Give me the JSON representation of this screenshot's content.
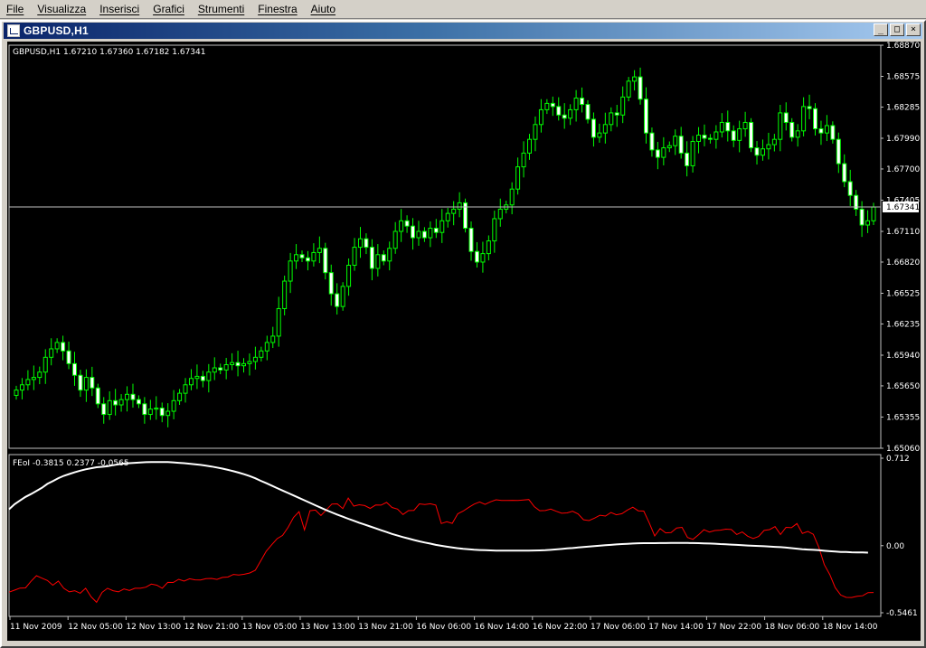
{
  "menu": [
    "File",
    "Visualizza",
    "Inserisci",
    "Grafici",
    "Strumenti",
    "Finestra",
    "Aiuto"
  ],
  "window": {
    "title": "GBPUSD,H1",
    "btn_min": "_",
    "btn_max": "□",
    "btn_close": "×"
  },
  "colors": {
    "bull": "#00ff00",
    "bear_body": "#ffffff",
    "grid": "#c0c0c0",
    "fisher": "#ff0000",
    "signal": "#ffffff",
    "axis_text": "#ffffff"
  },
  "chart_data": [
    {
      "type": "candlestick",
      "title": "GBPUSD,H1  1.67210 1.67360 1.67182 1.67341",
      "ylim": [
        1.6506,
        1.6887
      ],
      "y_ticks": [
        "1.68870",
        "1.68575",
        "1.68285",
        "1.67990",
        "1.67700",
        "1.67405",
        "1.67110",
        "1.66820",
        "1.66525",
        "1.66235",
        "1.65940",
        "1.65650",
        "1.65355",
        "1.65060"
      ],
      "last_price": "1.67341",
      "last_price_value": 1.67341,
      "closes": [
        1.6561,
        1.6566,
        1.6571,
        1.6573,
        1.6578,
        1.6592,
        1.66,
        1.6606,
        1.6598,
        1.6586,
        1.6575,
        1.6561,
        1.6573,
        1.6563,
        1.6548,
        1.6538,
        1.6551,
        1.6547,
        1.6552,
        1.6557,
        1.6552,
        1.6548,
        1.6538,
        1.6543,
        1.6544,
        1.6537,
        1.6541,
        1.6551,
        1.6558,
        1.6566,
        1.6572,
        1.6574,
        1.657,
        1.6578,
        1.6582,
        1.658,
        1.6585,
        1.6587,
        1.6584,
        1.6586,
        1.6588,
        1.6592,
        1.6598,
        1.6606,
        1.6612,
        1.6638,
        1.6664,
        1.6683,
        1.6689,
        1.6686,
        1.6683,
        1.6691,
        1.6695,
        1.6672,
        1.6652,
        1.664,
        1.6659,
        1.6679,
        1.6696,
        1.6704,
        1.6696,
        1.6676,
        1.6689,
        1.6683,
        1.6695,
        1.6711,
        1.6721,
        1.6716,
        1.6705,
        1.6711,
        1.6705,
        1.6714,
        1.671,
        1.6721,
        1.6728,
        1.6732,
        1.6738,
        1.6714,
        1.6692,
        1.6682,
        1.669,
        1.6702,
        1.6723,
        1.6732,
        1.6736,
        1.6751,
        1.6772,
        1.6785,
        1.6798,
        1.6812,
        1.6826,
        1.6832,
        1.6829,
        1.6821,
        1.6818,
        1.6826,
        1.6837,
        1.6831,
        1.6817,
        1.68,
        1.6804,
        1.6812,
        1.6823,
        1.6821,
        1.6838,
        1.6853,
        1.6857,
        1.6836,
        1.6804,
        1.6788,
        1.6781,
        1.679,
        1.6792,
        1.6801,
        1.6785,
        1.6773,
        1.6796,
        1.6802,
        1.6799,
        1.6798,
        1.6805,
        1.6814,
        1.6806,
        1.6797,
        1.6808,
        1.6814,
        1.679,
        1.6783,
        1.6789,
        1.6793,
        1.6798,
        1.6823,
        1.6814,
        1.68,
        1.6806,
        1.6829,
        1.6827,
        1.6808,
        1.6804,
        1.6811,
        1.6798,
        1.6775,
        1.6758,
        1.6745,
        1.6732,
        1.6717,
        1.6721,
        1.6734
      ]
    },
    {
      "type": "line",
      "title": "FEoI -0.3815 0.2377 -0.0565",
      "ylim": [
        -0.5461,
        0.712
      ],
      "y_ticks": [
        "0.712",
        "0.00",
        "-0.5461"
      ],
      "series": [
        {
          "values": [
            -0.3785,
            -0.362,
            -0.3456,
            -0.3441,
            -0.291,
            -0.2446,
            -0.2641,
            -0.2836,
            -0.3216,
            -0.2886,
            -0.3467,
            -0.3762,
            -0.3667,
            -0.3871,
            -0.3467,
            -0.4167,
            -0.4611,
            -0.38,
            -0.3467,
            -0.3667,
            -0.3762,
            -0.3526,
            -0.3641,
            -0.3467,
            -0.3467,
            -0.3377,
            -0.3132,
            -0.3216,
            -0.3467,
            -0.2986,
            -0.2996,
            -0.2741,
            -0.2886,
            -0.2696,
            -0.2786,
            -0.2791,
            -0.2686,
            -0.2666,
            -0.2746,
            -0.2581,
            -0.2556,
            -0.2341,
            -0.2386,
            -0.2326,
            -0.2222,
            -0.2001,
            -0.1236,
            -0.0451,
            0.0069,
            0.0574,
            0.0834,
            0.1494,
            0.2299,
            0.2769,
            0.1289,
            0.2844,
            0.2899,
            0.2459,
            0.2909,
            0.3389,
            0.3404,
            0.3024,
            0.3879,
            0.3219,
            0.3329,
            0.3264,
            0.3039,
            0.3309,
            0.3299,
            0.3519,
            0.3109,
            0.2978,
            0.2538,
            0.2853,
            0.2878,
            0.3408,
            0.3353,
            0.3413,
            0.3299,
            0.1798,
            0.1948,
            0.1813,
            0.2598,
            0.2813,
            0.3119,
            0.3379,
            0.3559,
            0.3359,
            0.3574,
            0.3739,
            0.3679,
            0.3679,
            0.3694,
            0.3679,
            0.3714,
            0.3759,
            0.3169,
            0.2849,
            0.2863,
            0.2978,
            0.2798,
            0.2638,
            0.2668,
            0.2798,
            0.2578,
            0.2108,
            0.2043,
            0.2244,
            0.2478,
            0.2408,
            0.2698,
            0.2518,
            0.2603,
            0.2898,
            0.3129,
            0.2838,
            0.2818,
            0.1868,
            0.0793,
            0.1398,
            0.1044,
            0.1069,
            0.1438,
            0.1489,
            0.0664,
            0.0514,
            0.0878,
            0.1299,
            0.1108,
            0.1234,
            0.1263,
            0.1348,
            0.1313,
            0.0908,
            0.1113,
            0.0774,
            0.0584,
            0.0748,
            0.1244,
            0.1308,
            0.1549,
            0.0913,
            0.1489,
            0.1463,
            0.1798,
            0.0998,
            0.1164,
            0.0924,
            -0.0125,
            -0.1536,
            -0.2346,
            -0.3416,
            -0.4016,
            -0.4211,
            -0.4221,
            -0.4121,
            -0.4076,
            -0.3821,
            -0.3815
          ]
        },
        {
          "values": [
            0.2962,
            0.3377,
            0.3677,
            0.3972,
            0.4198,
            0.4448,
            0.4708,
            0.5033,
            0.5253,
            0.5493,
            0.5683,
            0.5833,
            0.5973,
            0.6103,
            0.6213,
            0.6303,
            0.6383,
            0.6418,
            0.6463,
            0.6553,
            0.6623,
            0.6683,
            0.6718,
            0.6748,
            0.6773,
            0.6793,
            0.6808,
            0.6808,
            0.6808,
            0.6801,
            0.6778,
            0.6748,
            0.6713,
            0.6673,
            0.6628,
            0.6578,
            0.6513,
            0.6443,
            0.6363,
            0.6273,
            0.6173,
            0.6063,
            0.5943,
            0.5813,
            0.5663,
            0.5483,
            0.5283,
            0.5088,
            0.4888,
            0.4688,
            0.4488,
            0.4288,
            0.4088,
            0.3888,
            0.3688,
            0.3488,
            0.3288,
            0.3088,
            0.2888,
            0.2708,
            0.2528,
            0.2358,
            0.2188,
            0.2028,
            0.1868,
            0.1718,
            0.1568,
            0.1408,
            0.1258,
            0.1108,
            0.0958,
            0.0823,
            0.0698,
            0.0578,
            0.0458,
            0.0353,
            0.0258,
            0.0168,
            0.0068,
            -0.0012,
            -0.0082,
            -0.0147,
            -0.0207,
            -0.0257,
            -0.0297,
            -0.0332,
            -0.0352,
            -0.0372,
            -0.0387,
            -0.0397,
            -0.0397,
            -0.0397,
            -0.0397,
            -0.0397,
            -0.0397,
            -0.0397,
            -0.0392,
            -0.0387,
            -0.0367,
            -0.0337,
            -0.0302,
            -0.0267,
            -0.0222,
            -0.0192,
            -0.0147,
            -0.0112,
            -0.0077,
            -0.0037,
            0.0003,
            0.0038,
            0.0068,
            0.0098,
            0.0128,
            0.0153,
            0.0178,
            0.0198,
            0.0203,
            0.0203,
            0.0203,
            0.0208,
            0.0213,
            0.0218,
            0.0218,
            0.0218,
            0.0218,
            0.0213,
            0.0203,
            0.0188,
            0.0173,
            0.0158,
            0.0133,
            0.0113,
            0.0088,
            0.0063,
            0.0038,
            0.0013,
            -0.0007,
            -0.0022,
            -0.0047,
            -0.0072,
            -0.0097,
            -0.0122,
            -0.0157,
            -0.0197,
            -0.0247,
            -0.0287,
            -0.0317,
            -0.0342,
            -0.0372,
            -0.0412,
            -0.0452,
            -0.0482,
            -0.0507,
            -0.0517,
            -0.0537,
            -0.0547,
            -0.0557,
            -0.0565
          ]
        }
      ],
      "x_labels": [
        "11 Nov 2009",
        "12 Nov 05:00",
        "12 Nov 13:00",
        "12 Nov 21:00",
        "13 Nov 05:00",
        "13 Nov 13:00",
        "13 Nov 21:00",
        "16 Nov 06:00",
        "16 Nov 14:00",
        "16 Nov 22:00",
        "17 Nov 06:00",
        "17 Nov 14:00",
        "17 Nov 22:00",
        "18 Nov 06:00",
        "18 Nov 14:00"
      ]
    }
  ]
}
